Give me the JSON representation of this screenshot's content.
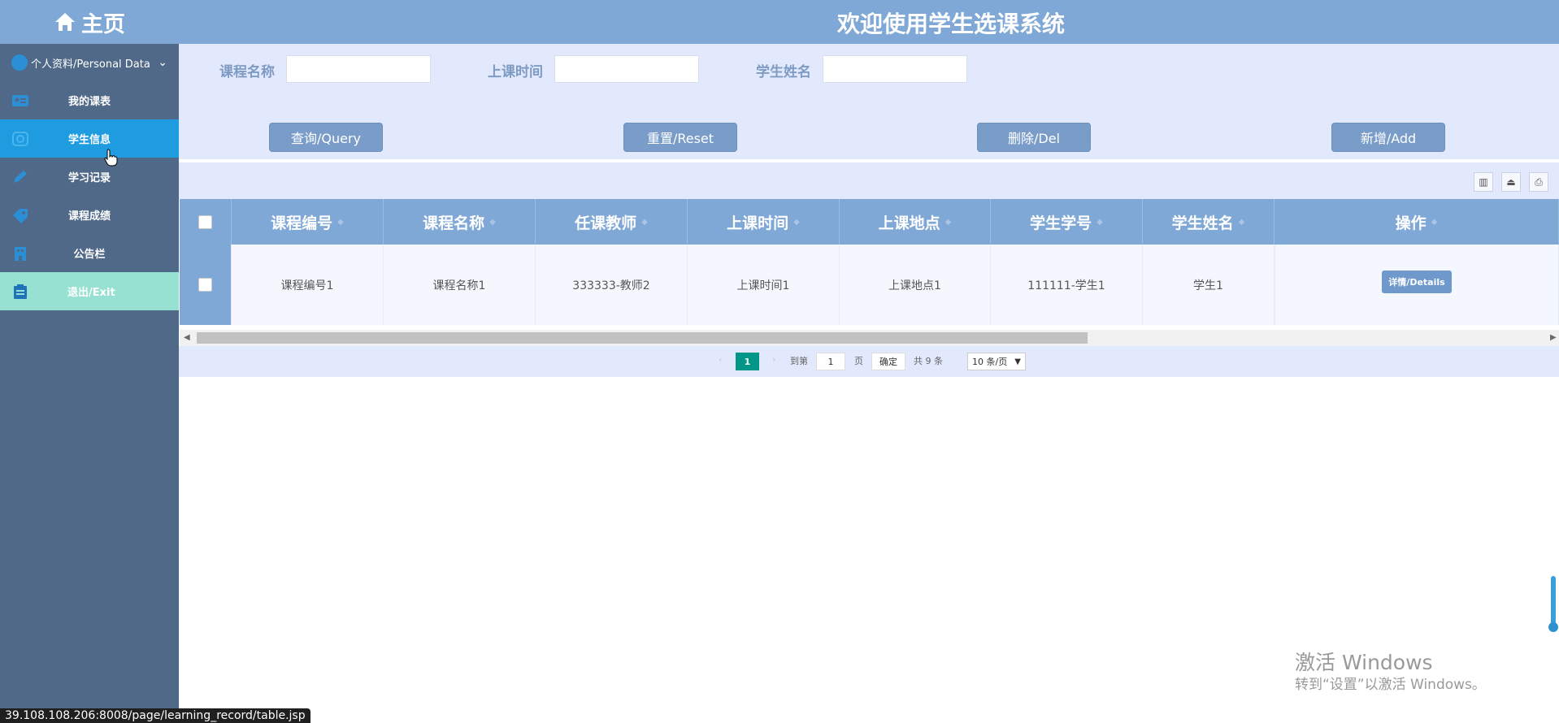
{
  "sidebar": {
    "home_label": "主页",
    "profile_label": "个人资料/Personal Data",
    "items": [
      {
        "label": "我的课表"
      },
      {
        "label": "学生信息"
      },
      {
        "label": "学习记录"
      },
      {
        "label": "课程成绩"
      },
      {
        "label": "公告栏"
      },
      {
        "label": "退出/Exit"
      }
    ]
  },
  "header": {
    "title": "欢迎使用学生选课系统"
  },
  "search": {
    "course_name_label": "课程名称",
    "class_time_label": "上课时间",
    "student_name_label": "学生姓名",
    "course_name_value": "",
    "class_time_value": "",
    "student_name_value": ""
  },
  "buttons": {
    "query": "查询/Query",
    "reset": "重置/Reset",
    "delete": "删除/Del",
    "add": "新增/Add"
  },
  "table": {
    "columns": [
      "课程编号",
      "课程名称",
      "任课教师",
      "上课时间",
      "上课地点",
      "学生学号",
      "学生姓名",
      "操作"
    ],
    "rows": [
      [
        "课程编号1",
        "课程名称1",
        "333333-教师2",
        "上课时间1",
        "上课地点1",
        "111111-学生1",
        "学生1"
      ]
    ],
    "details_label": "详情/Details"
  },
  "pagination": {
    "current_page": "1",
    "goto_label": "到第",
    "goto_value": "1",
    "page_suffix": "页",
    "confirm": "确定",
    "total": "共 9 条",
    "page_size": "10 条/页"
  },
  "statusbar": {
    "url": "39.108.108.206:8008/page/learning_record/table.jsp"
  },
  "watermark": {
    "line1": "激活 Windows",
    "line2": "转到“设置”以激活 Windows。"
  },
  "colors": {
    "header": "#7fa8d6",
    "sidebar": "#506988",
    "active_item": "#1f9be0",
    "exit_item": "#97e1d3",
    "button": "#799cc9",
    "page_current": "#009688"
  }
}
